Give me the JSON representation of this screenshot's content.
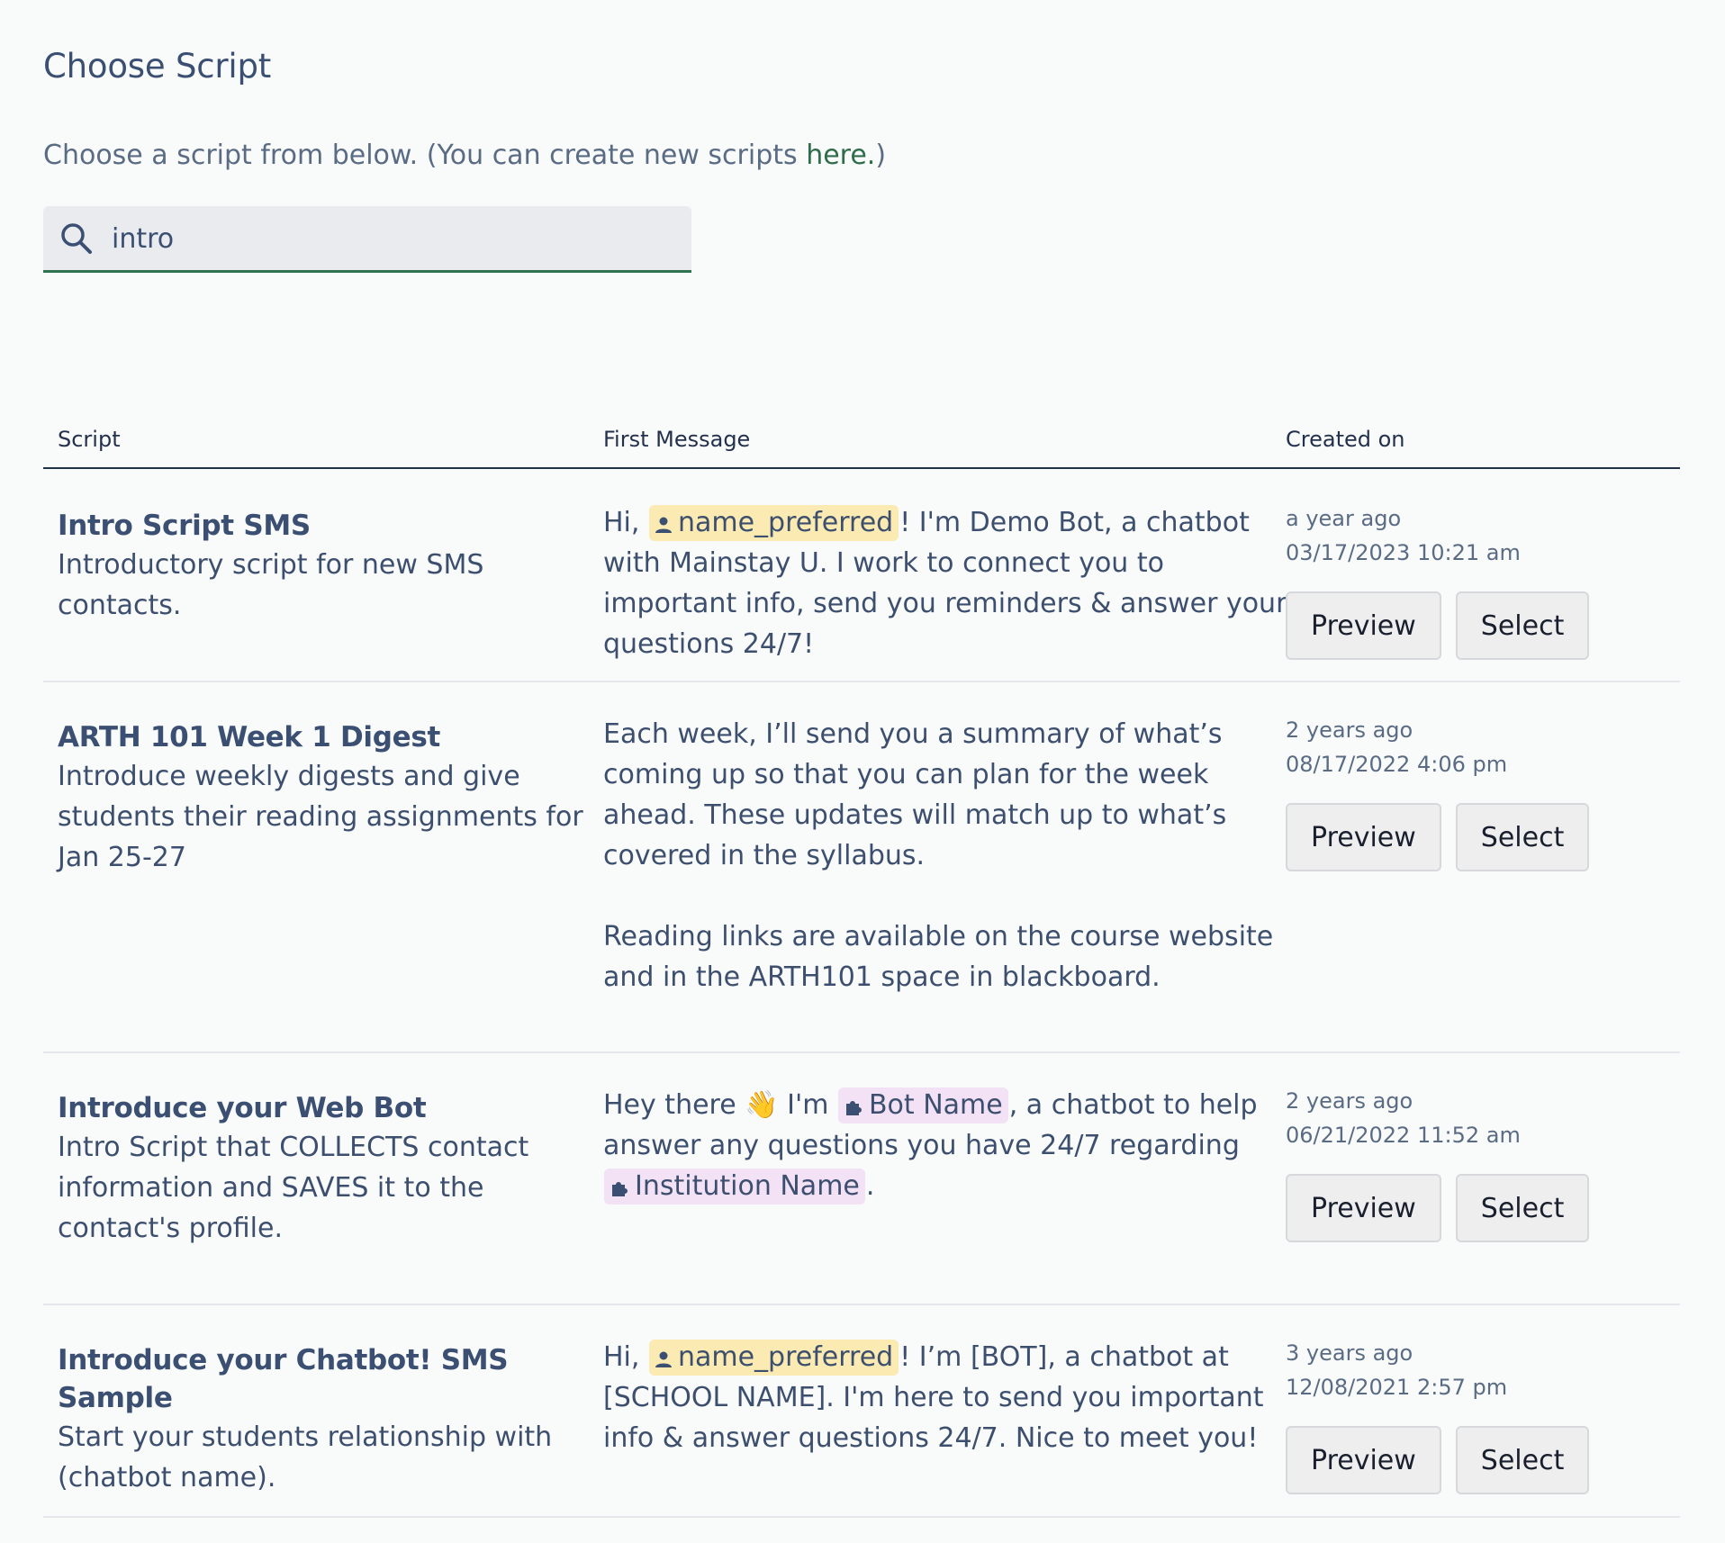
{
  "header": {
    "title": "Choose Script",
    "subtitle_prefix": "Choose a script from below. (You can create new scripts ",
    "subtitle_link": "here.",
    "subtitle_suffix": ")"
  },
  "search": {
    "icon": "search-icon",
    "value": "intro"
  },
  "table": {
    "columns": [
      "Script",
      "First Message",
      "Created on"
    ],
    "buttons": {
      "preview": "Preview",
      "select": "Select"
    },
    "rows": [
      {
        "name": "Intro Script SMS",
        "description": "Introductory script for new SMS contacts.",
        "message": {
          "pre": "Hi, ",
          "chip": "name_preferred",
          "post": "! I'm Demo Bot, a chatbot with Mainstay U. I work to connect you to important info, send you reminders & answer your questions 24/7!"
        },
        "relative": "a year ago",
        "date": "03/17/2023 10:21 am"
      },
      {
        "name": "ARTH 101 Week 1 Digest",
        "description": "Introduce weekly digests and give students their reading assignments for Jan 25-27",
        "message": {
          "p1": "Each week, I’ll send you a summary of what’s coming up so that you can plan for the week ahead. These updates will match up to what’s covered in the syllabus.",
          "p2": "Reading links are available on the course website and in the ARTH101 space in blackboard."
        },
        "relative": "2 years ago",
        "date": "08/17/2022 4:06 pm"
      },
      {
        "name": "Introduce your Web Bot",
        "description": "Intro Script that COLLECTS contact information and SAVES it to the contact's profile.",
        "message": {
          "pre": "Hey there ",
          "emoji": "👋",
          "mid1": " I'm ",
          "chip1": "Bot Name",
          "mid2": ", a chatbot to help answer any questions you have 24/7 regarding ",
          "chip2": "Institution Name",
          "post": "."
        },
        "relative": "2 years ago",
        "date": "06/21/2022 11:52 am"
      },
      {
        "name": "Introduce your Chatbot! SMS Sample",
        "description": "Start your students relationship with (chatbot name).",
        "message": {
          "pre": "Hi, ",
          "chip": "name_preferred",
          "post": "! I’m [BOT], a chatbot at [SCHOOL NAME]. I'm here to send you important info & answer questions 24/7. Nice to meet you!"
        },
        "relative": "3 years ago",
        "date": "12/08/2021 2:57 pm"
      }
    ]
  },
  "colors": {
    "accent_green": "#2f7350",
    "text_navy": "#3a4f72",
    "chip_user_bg": "#fbeab1",
    "chip_var_bg": "#f3e2f6"
  }
}
